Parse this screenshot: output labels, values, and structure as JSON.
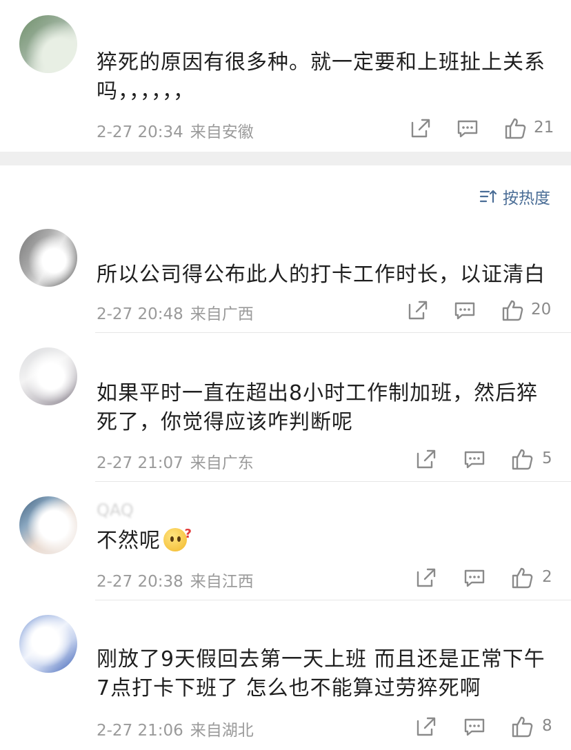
{
  "sort_label": "按热度",
  "comments": [
    {
      "username": "",
      "text": "猝死的原因有很多种。就一定要和上班扯上关系吗，，，，，，",
      "time": "2-27 20:34",
      "location": "来自安徽",
      "likes": "21"
    },
    {
      "username": "",
      "text": "所以公司得公布此人的打卡工作时长，以证清白",
      "time": "2-27 20:48",
      "location": "来自广西",
      "likes": "20"
    },
    {
      "username": "",
      "text": "如果平时一直在超出8小时工作制加班，然后猝死了，你觉得应该咋判断呢",
      "time": "2-27 21:07",
      "location": "来自广东",
      "likes": "5"
    },
    {
      "username": "QAQ",
      "text": "不然呢",
      "time": "2-27 20:38",
      "location": "来自江西",
      "likes": "2"
    },
    {
      "username": "",
      "text": "刚放了9天假回去第一天上班 而且还是正常下午7点打卡下班了 怎么也不能算过劳猝死啊",
      "time": "2-27 21:06",
      "location": "来自湖北",
      "likes": "8"
    }
  ],
  "icons": {
    "share": "share-icon",
    "reply": "comment-icon",
    "like": "thumbs-up-icon",
    "sort": "sort-icon",
    "emoji": "thinking-emoji-icon"
  },
  "colors": {
    "meta": "#9a9a9a",
    "sort": "#4a6d96",
    "divider": "#e6e6e6"
  }
}
